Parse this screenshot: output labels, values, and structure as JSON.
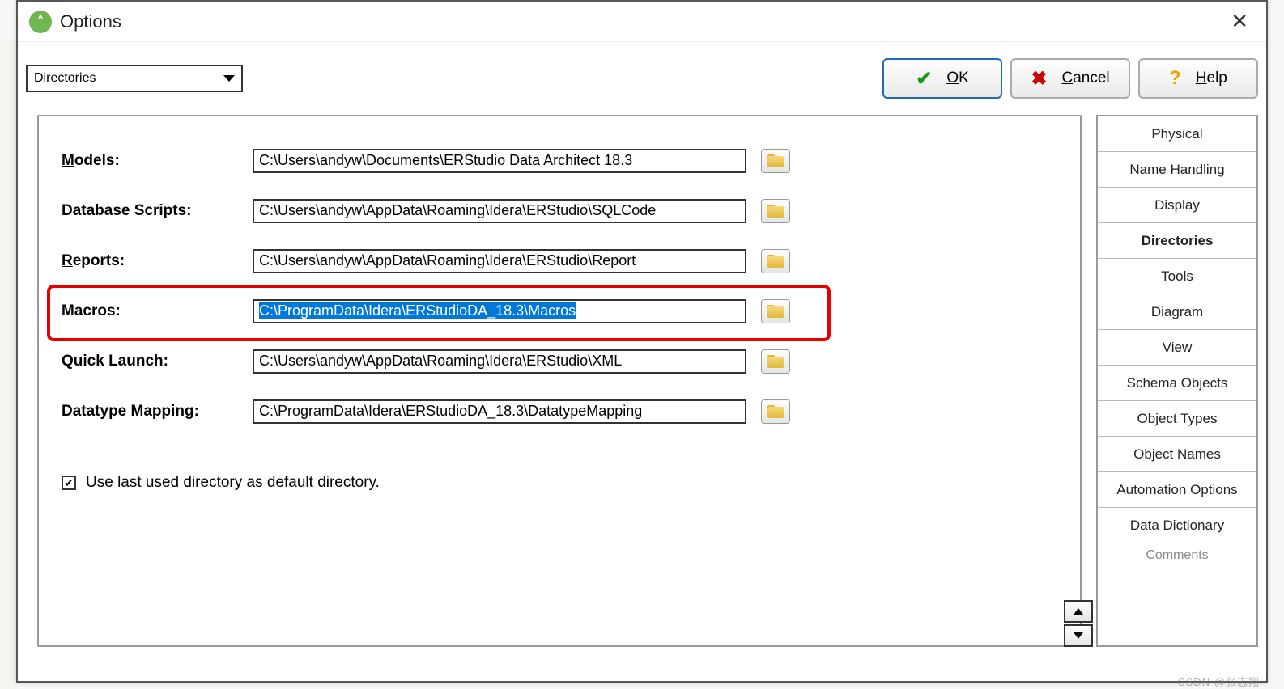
{
  "window": {
    "title": "Options",
    "close_glyph": "✕"
  },
  "category": {
    "selected": "Directories"
  },
  "buttons": {
    "ok": {
      "label": "OK",
      "underline": "O",
      "suffix": "K"
    },
    "cancel": {
      "label": "Cancel",
      "underline": "C",
      "suffix": "ancel"
    },
    "help": {
      "label": "Help",
      "underline": "H",
      "suffix": "elp"
    }
  },
  "directories": {
    "rows": [
      {
        "id": "models",
        "label_pre": "",
        "label_u": "M",
        "label_post": "odels:",
        "value": "C:\\Users\\andyw\\Documents\\ERStudio Data Architect 18.3",
        "highlighted": false,
        "selected": false
      },
      {
        "id": "dbscripts",
        "label_pre": "Database Scripts:",
        "label_u": "",
        "label_post": "",
        "value": "C:\\Users\\andyw\\AppData\\Roaming\\Idera\\ERStudio\\SQLCode",
        "highlighted": false,
        "selected": false
      },
      {
        "id": "reports",
        "label_pre": "",
        "label_u": "R",
        "label_post": "eports:",
        "value": "C:\\Users\\andyw\\AppData\\Roaming\\Idera\\ERStudio\\Report",
        "highlighted": false,
        "selected": false
      },
      {
        "id": "macros",
        "label_pre": "Macros:",
        "label_u": "",
        "label_post": "",
        "value": "C:\\ProgramData\\Idera\\ERStudioDA_18.3\\Macros",
        "highlighted": true,
        "selected": true
      },
      {
        "id": "quicklaunch",
        "label_pre": "Quick Launch:",
        "label_u": "",
        "label_post": "",
        "value": "C:\\Users\\andyw\\AppData\\Roaming\\Idera\\ERStudio\\XML",
        "highlighted": false,
        "selected": false
      },
      {
        "id": "datatype",
        "label_pre": "Datatype Mapping:",
        "label_u": "",
        "label_post": "",
        "value": "C:\\ProgramData\\Idera\\ERStudioDA_18.3\\DatatypeMapping",
        "highlighted": false,
        "selected": false
      }
    ],
    "checkbox": {
      "checked": true,
      "label": "Use last used directory as default directory."
    }
  },
  "side_tabs": [
    {
      "label": "Physical",
      "active": false
    },
    {
      "label": "Name Handling",
      "active": false
    },
    {
      "label": "Display",
      "active": false
    },
    {
      "label": "Directories",
      "active": true
    },
    {
      "label": "Tools",
      "active": false
    },
    {
      "label": "Diagram",
      "active": false
    },
    {
      "label": "View",
      "active": false
    },
    {
      "label": "Schema Objects",
      "active": false
    },
    {
      "label": "Object Types",
      "active": false
    },
    {
      "label": "Object Names",
      "active": false
    },
    {
      "label": "Automation Options",
      "active": false
    },
    {
      "label": "Data Dictionary",
      "active": false
    },
    {
      "label": "Comments",
      "active": false,
      "partial": true
    }
  ],
  "watermark": "CSDN @张志翔"
}
